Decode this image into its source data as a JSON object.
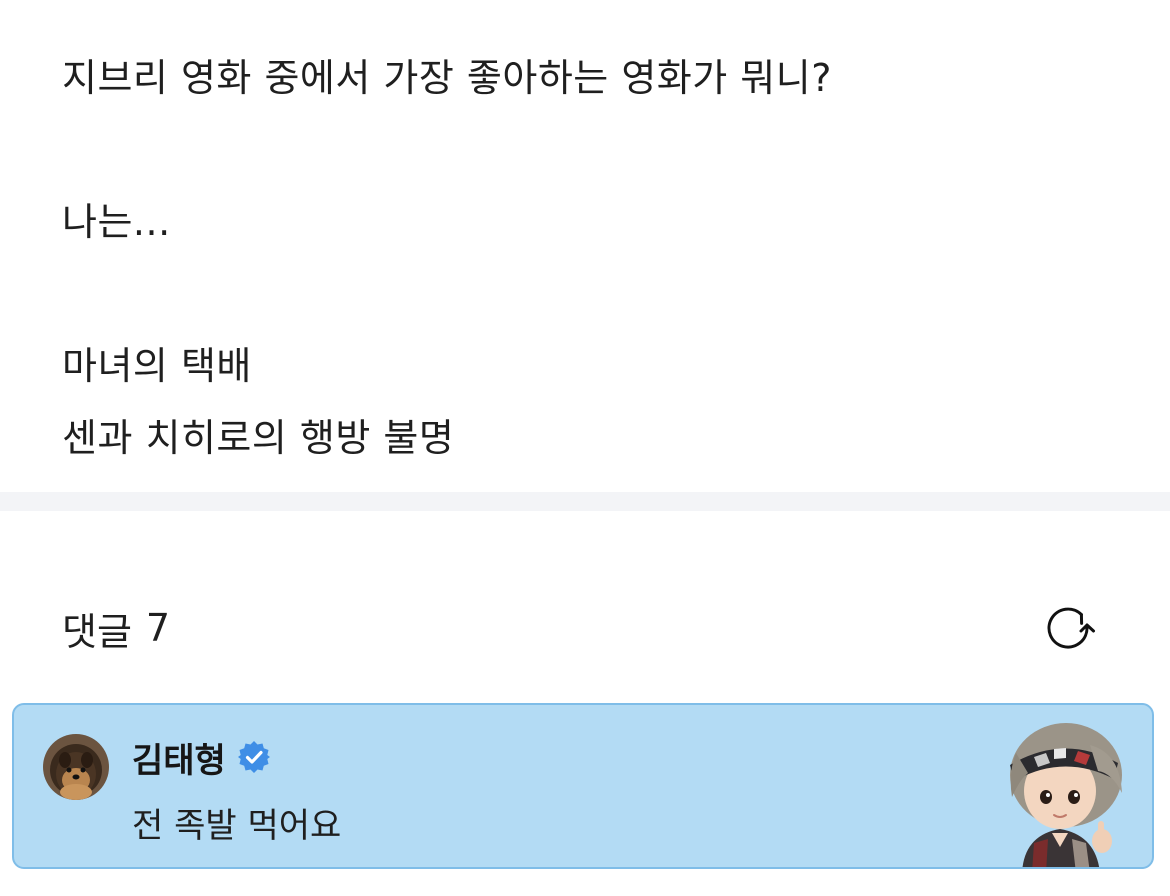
{
  "post": {
    "lines": [
      "지브리 영화 중에서 가장 좋아하는 영화가 뭐니?",
      "나는...",
      "마녀의 택배",
      "센과 치히로의 행방 불명"
    ]
  },
  "comments": {
    "label": "댓글",
    "count": "7",
    "refresh_icon": "refresh-icon"
  },
  "comment": {
    "author": "김태형",
    "verified_icon": "verified-badge-icon",
    "text": "전 족발 먹어요",
    "card_color": "#b3dbf4",
    "border_color": "#7fbde8",
    "badge_color": "#3f8ee6"
  }
}
